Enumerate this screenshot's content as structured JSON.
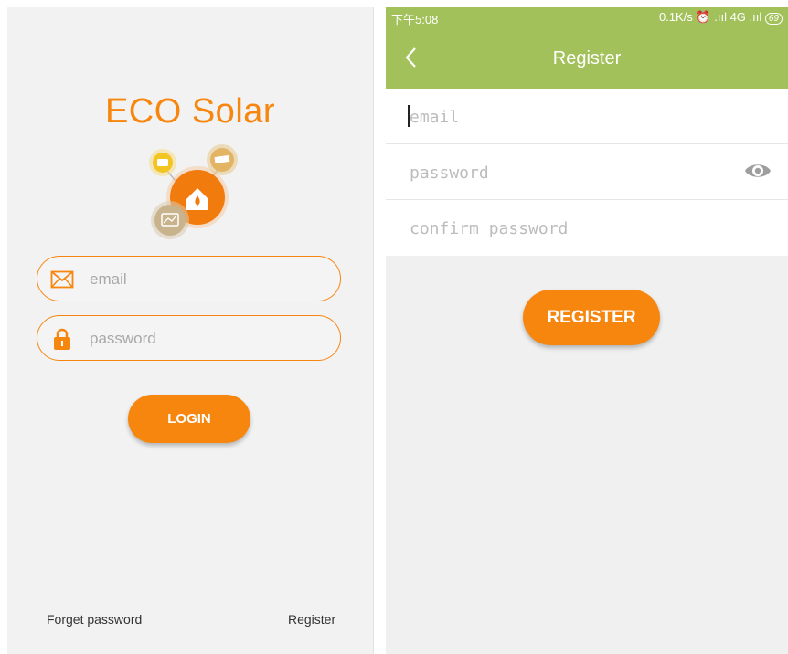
{
  "login": {
    "app_title": "ECO Solar",
    "email_placeholder": "email",
    "password_placeholder": "password",
    "login_label": "LOGIN",
    "forget_password": "Forget password",
    "register_link": "Register",
    "accent_color": "#f7860f",
    "icons": [
      "envelope-icon",
      "lock-icon",
      "eco-solar-logo"
    ]
  },
  "register": {
    "status_bar": {
      "time": "下午5:08",
      "right": "0.1K/s ⏰ .ııl 4G .ııl",
      "battery": "69"
    },
    "title": "Register",
    "email_placeholder": "email",
    "password_placeholder": "password",
    "confirm_placeholder": "confirm password",
    "register_label": "REGISTER",
    "header_color": "#a2c15a",
    "icons": [
      "back-arrow-icon",
      "eye-icon"
    ]
  }
}
